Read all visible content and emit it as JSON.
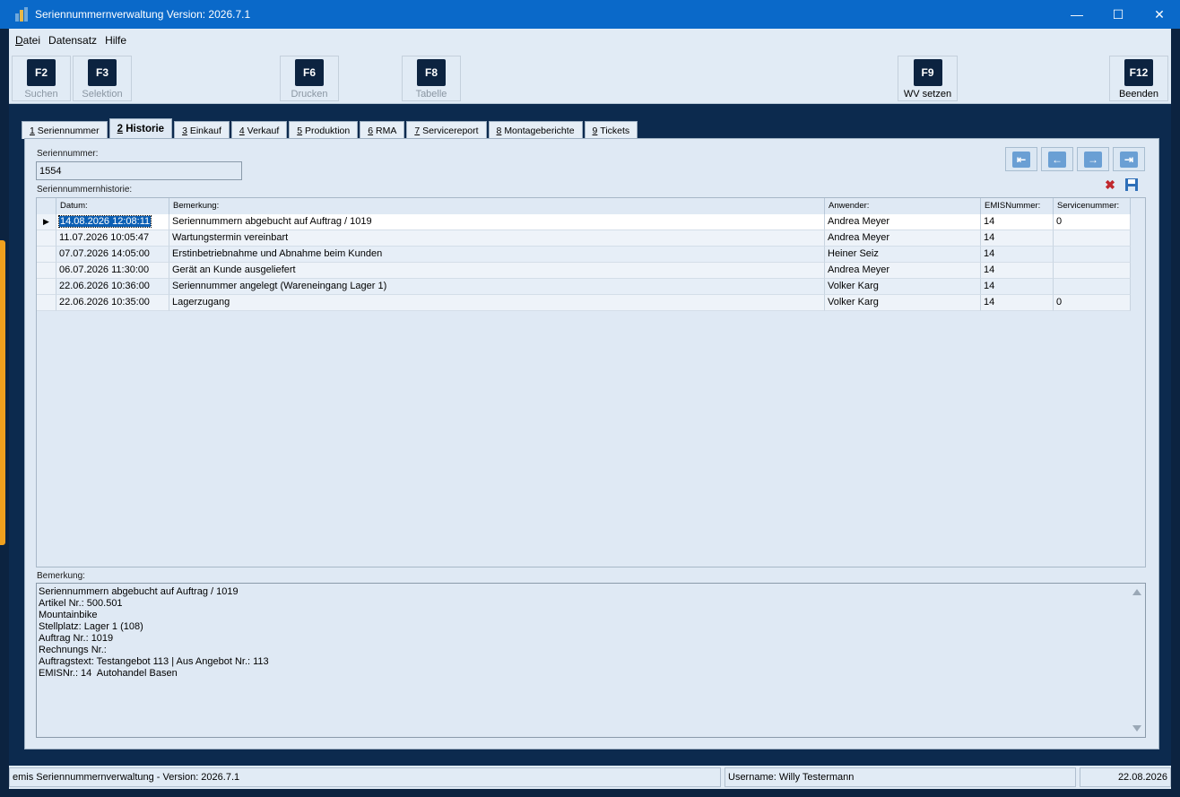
{
  "window": {
    "title": "Seriennummernverwaltung Version: 2026.7.1",
    "controls": {
      "minimize": "—",
      "maximize": "☐",
      "close": "✕"
    }
  },
  "menu": [
    {
      "accel": "D",
      "rest": "atei"
    },
    {
      "accel": "",
      "rest": "Datensatz"
    },
    {
      "accel": "",
      "rest": "Hilfe"
    }
  ],
  "toolbar": {
    "f2": {
      "key": "F2",
      "label": "Suchen"
    },
    "f3": {
      "key": "F3",
      "label": "Selektion"
    },
    "f6": {
      "key": "F6",
      "label": "Drucken"
    },
    "f8": {
      "key": "F8",
      "label": "Tabelle"
    },
    "f9": {
      "key": "F9",
      "label": "WV setzen"
    },
    "f12": {
      "key": "F12",
      "label": "Beenden"
    }
  },
  "tabs": [
    {
      "num": "1",
      "label": "Seriennummer"
    },
    {
      "num": "2",
      "label": "Historie"
    },
    {
      "num": "3",
      "label": "Einkauf"
    },
    {
      "num": "4",
      "label": "Verkauf"
    },
    {
      "num": "5",
      "label": "Produktion"
    },
    {
      "num": "6",
      "label": "RMA"
    },
    {
      "num": "7",
      "label": "Servicereport"
    },
    {
      "num": "8",
      "label": "Montageberichte"
    },
    {
      "num": "9",
      "label": "Tickets"
    }
  ],
  "form": {
    "seriennummer_label": "Seriennummer:",
    "seriennummer_value": "1554",
    "history_label": "Seriennummernhistorie:",
    "bemerkung_label": "Bemerkung:"
  },
  "nav": {
    "first": "⇤",
    "prev": "←",
    "next": "→",
    "last": "⇥"
  },
  "grid": {
    "columns": [
      "Datum:",
      "Bemerkung:",
      "Anwender:",
      "EMISNummer:",
      "Servicenummer:"
    ],
    "rows": [
      [
        "14.08.2026 12:08:11",
        "Seriennummern abgebucht auf Auftrag / 1019",
        "Andrea Meyer",
        "14",
        "0"
      ],
      [
        "11.07.2026 10:05:47",
        "Wartungstermin vereinbart",
        "Andrea Meyer",
        "14",
        ""
      ],
      [
        "07.07.2026 14:05:00",
        "Erstinbetriebnahme und Abnahme beim Kunden",
        "Heiner Seiz",
        "14",
        ""
      ],
      [
        "06.07.2026 11:30:00",
        "Gerät an Kunde ausgeliefert",
        "Andrea Meyer",
        "14",
        ""
      ],
      [
        "22.06.2026 10:36:00",
        "Seriennummer angelegt (Wareneingang Lager 1)",
        "Volker Karg",
        "14",
        ""
      ],
      [
        "22.06.2026 10:35:00",
        "Lagerzugang",
        "Volker Karg",
        "14",
        "0"
      ]
    ]
  },
  "memo_lines": [
    "Seriennummern abgebucht auf Auftrag / 1019",
    "Artikel Nr.: 500.501",
    "Mountainbike",
    "Stellplatz: Lager 1 (108)",
    "Auftrag Nr.: 1019",
    "Rechnungs Nr.:",
    "Auftragstext: Testangebot 113 | Aus Angebot Nr.: 113",
    "EMISNr.: 14  Autohandel Basen"
  ],
  "status": {
    "app": "emis Seriennummernverwaltung - Version: 2026.7.1",
    "user": "Username: Willy Testermann",
    "date": "22.08.2026"
  },
  "colors": {
    "titlebar": "#0a69c9",
    "background": "#0c2340",
    "panel": "#dfe9f4",
    "selection": "#0b5fb4",
    "accent_strip": "#f0a01e"
  }
}
